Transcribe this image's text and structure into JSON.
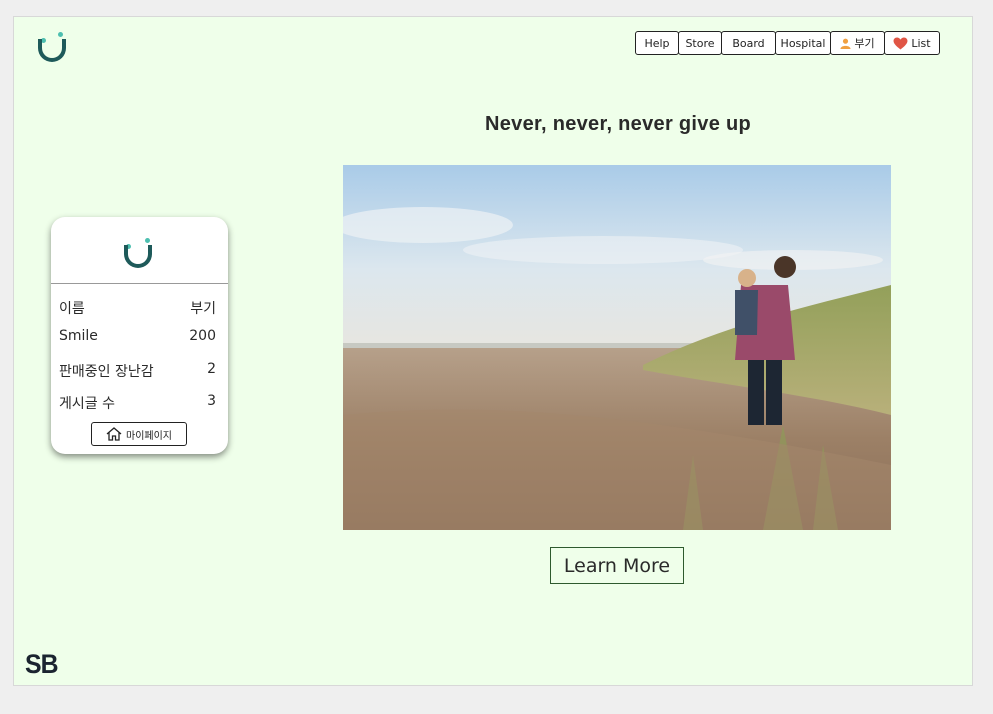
{
  "nav": {
    "help": "Help",
    "store": "Store",
    "board": "Board",
    "hospital": "Hospital",
    "user": "부기",
    "list": "List"
  },
  "main": {
    "headline": "Never, never, never give up",
    "learn_more": "Learn More"
  },
  "profile_card": {
    "rows": [
      {
        "label": "이름",
        "value": "부기"
      },
      {
        "label": "Smile",
        "value": "200"
      },
      {
        "label": "판매중인 장난감",
        "value": "2"
      },
      {
        "label": "게시글 수",
        "value": "3"
      }
    ],
    "mypage_button": "마이페이지"
  },
  "footer": {
    "brand": "SB"
  },
  "colors": {
    "page_bg": "#efffea",
    "logo_dot": "#4dbfb0",
    "logo_smile": "#1e5a5a",
    "heart": "#e05545",
    "user_icon": "#f0a040"
  }
}
